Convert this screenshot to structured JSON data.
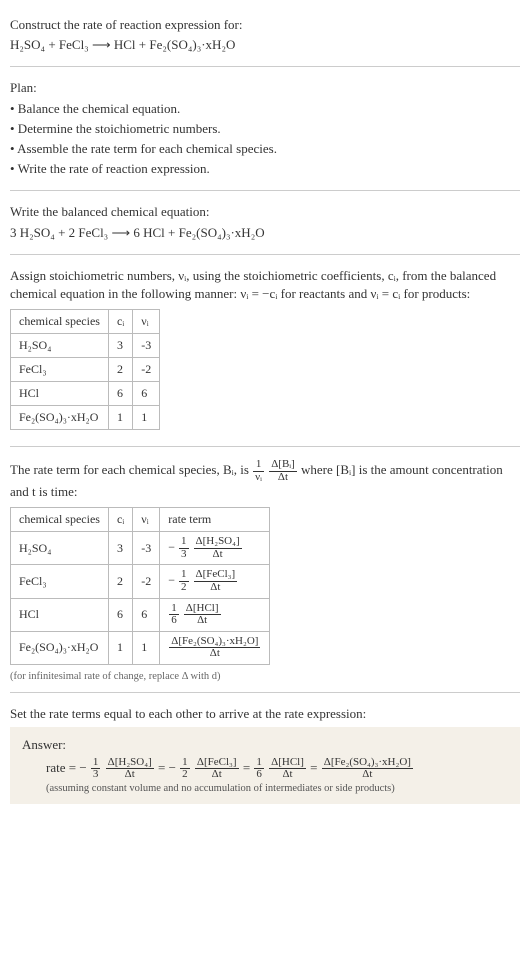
{
  "header": {
    "construct": "Construct the rate of reaction expression for:",
    "equation": "H₂SO₄ + FeCl₃ ⟶ HCl + Fe₂(SO₄)₃·xH₂O"
  },
  "plan": {
    "title": "Plan:",
    "items": [
      "• Balance the chemical equation.",
      "• Determine the stoichiometric numbers.",
      "• Assemble the rate term for each chemical species.",
      "• Write the rate of reaction expression."
    ]
  },
  "balanced": {
    "title": "Write the balanced chemical equation:",
    "equation": "3 H₂SO₄ + 2 FeCl₃ ⟶ 6 HCl + Fe₂(SO₄)₃·xH₂O"
  },
  "assign": {
    "text": "Assign stoichiometric numbers, νᵢ, using the stoichiometric coefficients, cᵢ, from the balanced chemical equation in the following manner: νᵢ = −cᵢ for reactants and νᵢ = cᵢ for products:",
    "headers": [
      "chemical species",
      "cᵢ",
      "νᵢ"
    ],
    "rows": [
      {
        "species": "H₂SO₄",
        "c": "3",
        "v": "-3"
      },
      {
        "species": "FeCl₃",
        "c": "2",
        "v": "-2"
      },
      {
        "species": "HCl",
        "c": "6",
        "v": "6"
      },
      {
        "species": "Fe₂(SO₄)₃·xH₂O",
        "c": "1",
        "v": "1"
      }
    ]
  },
  "rateterm": {
    "pre": "The rate term for each chemical species, Bᵢ, is ",
    "post": " where [Bᵢ] is the amount concentration and t is time:",
    "nu_inv_num": "1",
    "nu_inv_den": "νᵢ",
    "db_num": "Δ[Bᵢ]",
    "db_den": "Δt",
    "headers": [
      "chemical species",
      "cᵢ",
      "νᵢ",
      "rate term"
    ],
    "rows": [
      {
        "species": "H₂SO₄",
        "c": "3",
        "v": "-3",
        "sign": "−",
        "cnum": "1",
        "cden": "3",
        "dnum": "Δ[H₂SO₄]",
        "dden": "Δt"
      },
      {
        "species": "FeCl₃",
        "c": "2",
        "v": "-2",
        "sign": "−",
        "cnum": "1",
        "cden": "2",
        "dnum": "Δ[FeCl₃]",
        "dden": "Δt"
      },
      {
        "species": "HCl",
        "c": "6",
        "v": "6",
        "sign": "",
        "cnum": "1",
        "cden": "6",
        "dnum": "Δ[HCl]",
        "dden": "Δt"
      },
      {
        "species": "Fe₂(SO₄)₃·xH₂O",
        "c": "1",
        "v": "1",
        "sign": "",
        "cnum": "",
        "cden": "",
        "dnum": "Δ[Fe₂(SO₄)₃·xH₂O]",
        "dden": "Δt"
      }
    ],
    "note": "(for infinitesimal rate of change, replace Δ with d)"
  },
  "set": {
    "text": "Set the rate terms equal to each other to arrive at the rate expression:"
  },
  "answer": {
    "label": "Answer:",
    "rate_label": "rate = ",
    "terms": [
      {
        "sign": "−",
        "cnum": "1",
        "cden": "3",
        "dnum": "Δ[H₂SO₄]",
        "dden": "Δt"
      },
      {
        "sign": "−",
        "cnum": "1",
        "cden": "2",
        "dnum": "Δ[FeCl₃]",
        "dden": "Δt"
      },
      {
        "sign": "",
        "cnum": "1",
        "cden": "6",
        "dnum": "Δ[HCl]",
        "dden": "Δt"
      },
      {
        "sign": "",
        "cnum": "",
        "cden": "",
        "dnum": "Δ[Fe₂(SO₄)₃·xH₂O]",
        "dden": "Δt"
      }
    ],
    "eq": " = ",
    "assume": "(assuming constant volume and no accumulation of intermediates or side products)"
  }
}
